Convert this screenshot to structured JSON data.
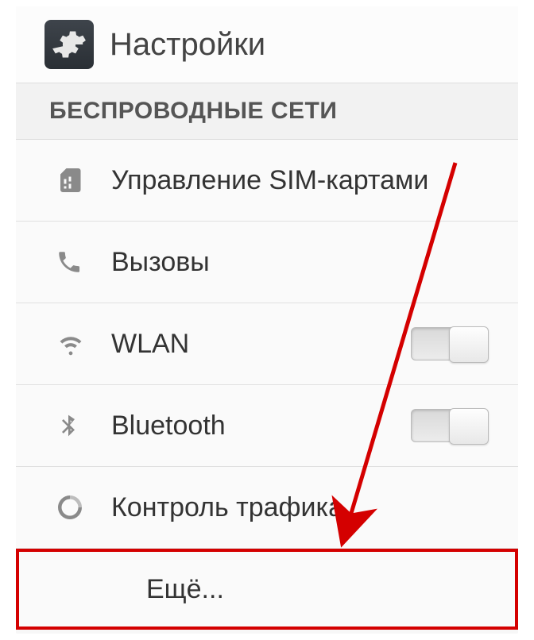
{
  "header": {
    "title": "Настройки",
    "icon": "gear"
  },
  "section": {
    "title": "БЕСПРОВОДНЫЕ СЕТИ"
  },
  "rows": {
    "sim": {
      "label": "Управление SIM-картами",
      "icon": "sim-icon"
    },
    "calls": {
      "label": "Вызовы",
      "icon": "phone-icon"
    },
    "wlan": {
      "label": "WLAN",
      "icon": "wifi-icon",
      "toggle": "off"
    },
    "bluetooth": {
      "label": "Bluetooth",
      "icon": "bluetooth-icon",
      "toggle": "off"
    },
    "traffic": {
      "label": "Контроль трафика",
      "icon": "data-usage-icon"
    },
    "more": {
      "label": "Ещё..."
    }
  },
  "annotation": {
    "highlight_target": "more",
    "arrow_color": "#d40000"
  }
}
